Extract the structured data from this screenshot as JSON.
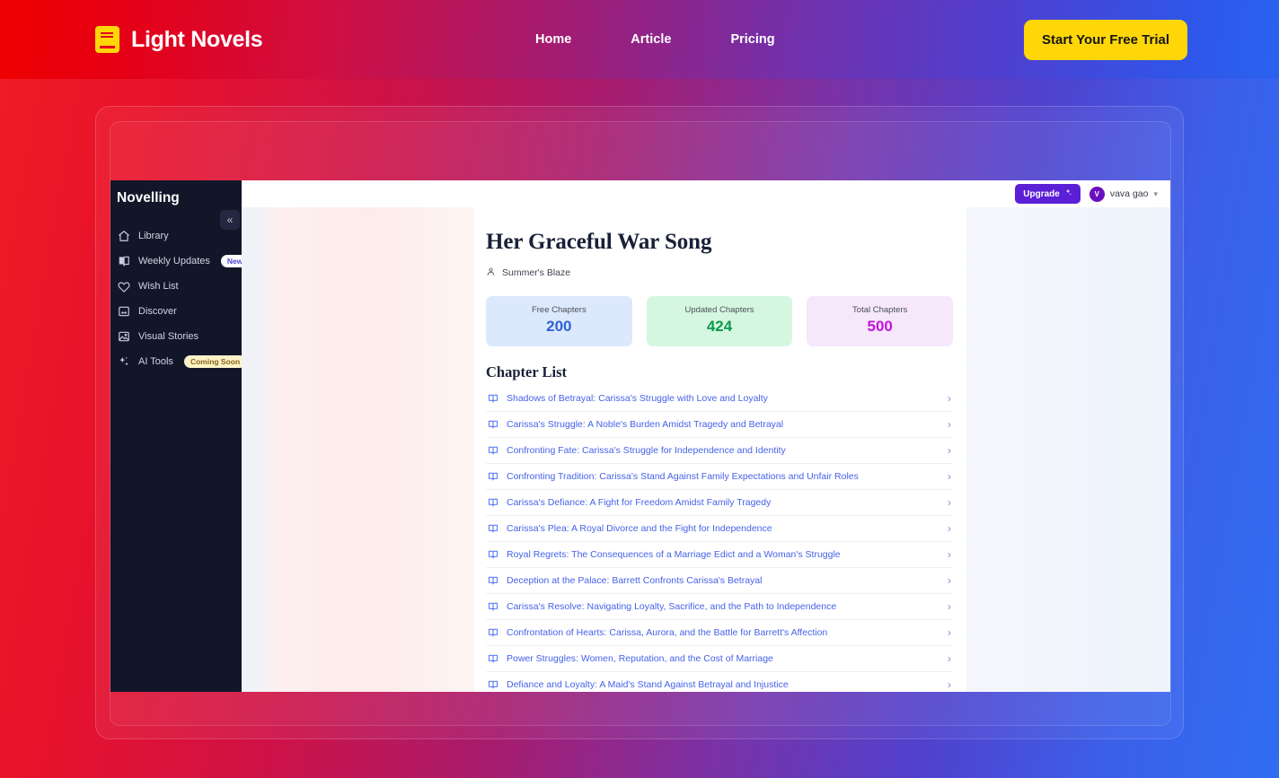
{
  "navbar": {
    "brand": "Light Novels",
    "brand_logo_icon": "book-icon",
    "links": [
      {
        "label": "Home"
      },
      {
        "label": "Article"
      },
      {
        "label": "Pricing"
      }
    ],
    "cta_label": "Start Your Free Trial",
    "cta_color": "#FFD608"
  },
  "app": {
    "sidebar": {
      "title": "Novelling",
      "collapse_icon": "chevron-double-left-icon",
      "items": [
        {
          "label": "Library",
          "icon": "home-icon",
          "badge": null
        },
        {
          "label": "Weekly Updates",
          "icon": "book-open-icon",
          "badge": "New"
        },
        {
          "label": "Wish List",
          "icon": "heart-icon",
          "badge": null
        },
        {
          "label": "Discover",
          "icon": "image-icon",
          "badge": null
        },
        {
          "label": "Visual Stories",
          "icon": "photo-icon",
          "badge": null
        },
        {
          "label": "AI Tools",
          "icon": "sparkles-icon",
          "badge": "Coming Soon"
        }
      ]
    },
    "topbar": {
      "upgrade_label": "Upgrade",
      "upgrade_icon": "sparkle-icon",
      "upgrade_color": "#5B1FD6",
      "user_initial": "V",
      "user_name": "vava gao",
      "chevron_icon": "chevron-down-icon"
    },
    "novel": {
      "title": "Her Graceful War Song",
      "author_icon": "user-icon",
      "author": "Summer's Blaze",
      "stats": [
        {
          "label": "Free Chapters",
          "value": "200",
          "color": "#2E62D8"
        },
        {
          "label": "Updated Chapters",
          "value": "424",
          "color": "#0F9A4B"
        },
        {
          "label": "Total Chapters",
          "value": "500",
          "color": "#C414E0"
        }
      ],
      "chapter_list_heading": "Chapter List",
      "chapter_icon": "book-open-icon",
      "chapter_chevron_icon": "chevron-right-icon",
      "chapters": [
        {
          "title": "Shadows of Betrayal: Carissa's Struggle with Love and Loyalty"
        },
        {
          "title": "Carissa's Struggle: A Noble's Burden Amidst Tragedy and Betrayal"
        },
        {
          "title": "Confronting Fate: Carissa's Struggle for Independence and Identity"
        },
        {
          "title": "Confronting Tradition: Carissa's Stand Against Family Expectations and Unfair Roles"
        },
        {
          "title": "Carissa's Defiance: A Fight for Freedom Amidst Family Tragedy"
        },
        {
          "title": "Carissa's Plea: A Royal Divorce and the Fight for Independence"
        },
        {
          "title": "Royal Regrets: The Consequences of a Marriage Edict and a Woman's Struggle"
        },
        {
          "title": "Deception at the Palace: Barrett Confronts Carissa's Betrayal"
        },
        {
          "title": "Carissa's Resolve: Navigating Loyalty, Sacrifice, and the Path to Independence"
        },
        {
          "title": "Confrontation of Hearts: Carissa, Aurora, and the Battle for Barrett's Affection"
        },
        {
          "title": "Power Struggles: Women, Reputation, and the Cost of Marriage"
        },
        {
          "title": "Defiance and Loyalty: A Maid's Stand Against Betrayal and Injustice"
        }
      ]
    }
  }
}
